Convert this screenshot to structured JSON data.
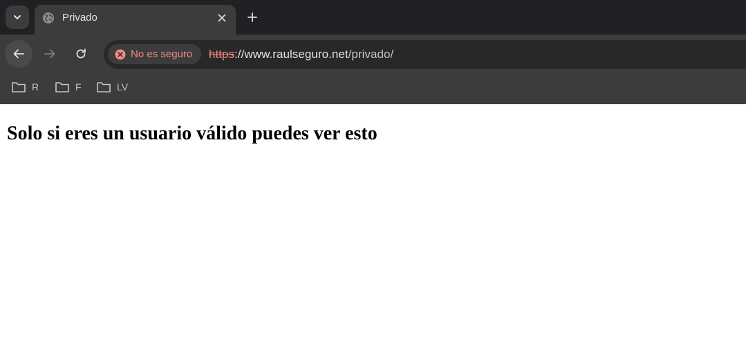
{
  "tabs": [
    {
      "title": "Privado",
      "favicon": "globe-icon",
      "active": true
    }
  ],
  "tabstrip": {
    "search_icon": "chevron-down-icon",
    "new_tab_icon": "plus-icon",
    "close_icon": "close-icon"
  },
  "toolbar": {
    "back_icon": "arrow-left-icon",
    "forward_icon": "arrow-right-icon",
    "reload_icon": "reload-icon"
  },
  "omnibox": {
    "security_label": "No es seguro",
    "security_icon": "not-secure-icon",
    "security_color": "#f28b82",
    "url_scheme": "https",
    "url_separator": "://",
    "url_host": "www.raulseguro.net",
    "url_path": "/privado/"
  },
  "bookmarks": [
    {
      "label": "R",
      "icon": "folder-icon"
    },
    {
      "label": "F",
      "icon": "folder-icon"
    },
    {
      "label": "LV",
      "icon": "folder-icon"
    }
  ],
  "page": {
    "heading": "Solo si eres un usuario válido puedes ver esto"
  }
}
